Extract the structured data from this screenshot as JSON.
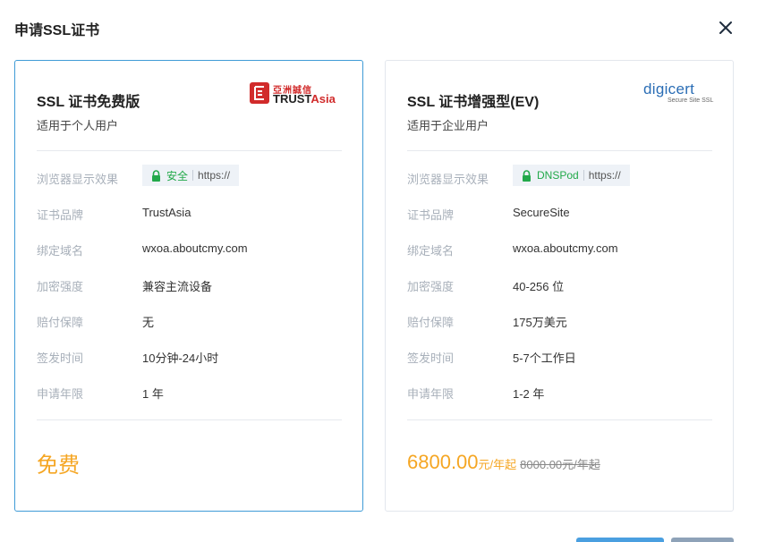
{
  "dialog": {
    "title": "申请SSL证书"
  },
  "cards": [
    {
      "name": "SSL 证书免费版",
      "subtitle": "适用于个人用户",
      "logo": {
        "cn_text": "亞洲誠信",
        "brand_a": "TRUST",
        "brand_b": "Asia"
      },
      "rows": {
        "browser_label": "浏览器显示效果",
        "browser_badge": "安全",
        "browser_url": "https://",
        "brand_label": "证书品牌",
        "brand_value": "TrustAsia",
        "domain_label": "绑定域名",
        "domain_value": "wxoa.aboutcmy.com",
        "strength_label": "加密强度",
        "strength_value": "兼容主流设备",
        "warranty_label": "赔付保障",
        "warranty_value": "无",
        "issue_label": "签发时间",
        "issue_value": "10分钟-24小时",
        "term_label": "申请年限",
        "term_value": "1 年"
      },
      "price": "免费"
    },
    {
      "name": "SSL 证书增强型(EV)",
      "subtitle": "适用于企业用户",
      "logo": {
        "brand": "digicert",
        "tagline": "Secure Site SSL"
      },
      "rows": {
        "browser_label": "浏览器显示效果",
        "browser_badge": "DNSPod",
        "browser_url": "https://",
        "brand_label": "证书品牌",
        "brand_value": "SecureSite",
        "domain_label": "绑定域名",
        "domain_value": "wxoa.aboutcmy.com",
        "strength_label": "加密强度",
        "strength_value": "40-256 位",
        "warranty_label": "赔付保障",
        "warranty_value": "175万美元",
        "issue_label": "签发时间",
        "issue_value": "5-7个工作日",
        "term_label": "申请年限",
        "term_value": "1-2 年"
      },
      "price": "6800.00",
      "price_unit": "元/年起",
      "price_old": "8000.00元/年起"
    }
  ],
  "colors": {
    "accent_border": "#3f9bd6",
    "price": "#f5a623",
    "secure_green": "#22a94a",
    "confirm_button": "#4a9fe0",
    "cancel_button": "#8ea2b8"
  },
  "icons": [
    "close-icon",
    "lock-icon",
    "trustasia-logo",
    "digicert-logo"
  ]
}
